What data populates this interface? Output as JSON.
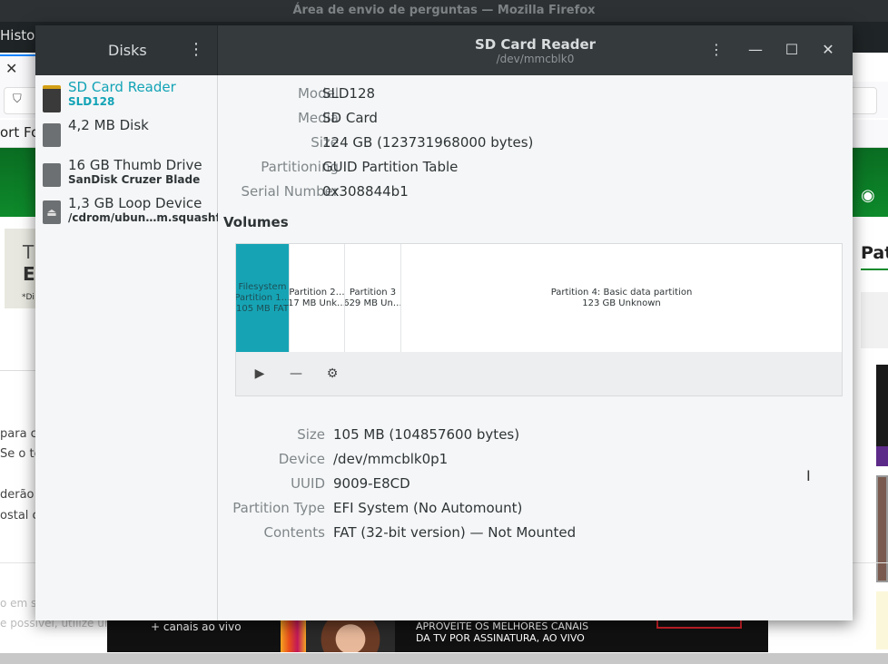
{
  "firefox": {
    "window_title": "Área de envio de perguntas — Mozilla Firefox",
    "history_menu": "Histor",
    "bookmark_text": "ort For",
    "card_text_1": "T",
    "card_text_2": "E",
    "card_text_3": "*Di",
    "side_heading": "Pat",
    "body_lines": [
      "para c",
      "Se o to",
      "derão",
      "ostal co"
    ],
    "footer_lines": [
      "o em s",
      "e possível, utilize un"
    ],
    "banner_left": "+ canais ao vivo",
    "banner_right_1": "APROVEITE OS MELHORES CANAIS",
    "banner_right_2": "DA TV POR ASSINATURA, AO VIVO"
  },
  "disks": {
    "sidebar_title": "Disks",
    "header_title": "SD Card Reader",
    "header_subtitle": "/dev/mmcblk0",
    "drives": [
      {
        "name": "SD Card Reader",
        "sub": "SLD128",
        "icon": "sd-card-icon"
      },
      {
        "name": "4,2 MB Disk",
        "sub": "",
        "icon": "hard-disk-icon"
      },
      {
        "name": "16 GB Thumb Drive",
        "sub": "SanDisk Cruzer Blade",
        "icon": "hard-disk-icon"
      },
      {
        "name": "1,3 GB Loop Device",
        "sub": "/cdrom/ubun…m.squashfs",
        "icon": "optical-disk-icon"
      }
    ],
    "properties": [
      {
        "label": "Model",
        "value": "SLD128"
      },
      {
        "label": "Media",
        "value": "SD Card"
      },
      {
        "label": "Size",
        "value": "124 GB (123731968000 bytes)"
      },
      {
        "label": "Partitioning",
        "value": "GUID Partition Table"
      },
      {
        "label": "Serial Number",
        "value": "0x308844b1"
      }
    ],
    "volumes_title": "Volumes",
    "volumes": [
      {
        "line1": "Filesystem",
        "line2": "Partition 1…",
        "line3": "105 MB FAT"
      },
      {
        "line1": "Partition 2…",
        "line2": "17 MB Unk…",
        "line3": ""
      },
      {
        "line1": "Partition 3",
        "line2": "629 MB Un…",
        "line3": ""
      },
      {
        "line1": "Partition 4: Basic data partition",
        "line2": "123 GB Unknown",
        "line3": ""
      }
    ],
    "volume_properties": [
      {
        "label": "Size",
        "value": "105 MB (104857600 bytes)"
      },
      {
        "label": "Device",
        "value": "/dev/mmcblk0p1"
      },
      {
        "label": "UUID",
        "value": "9009-E8CD"
      },
      {
        "label": "Partition Type",
        "value": "EFI System (No Automount)"
      },
      {
        "label": "Contents",
        "value": "FAT (32-bit version) — Not Mounted"
      }
    ],
    "icons": {
      "menu": "⋮",
      "minimize": "—",
      "maximize": "☐",
      "close": "✕",
      "play": "▶",
      "remove": "—",
      "settings": "⚙"
    },
    "accent_color": "#12a3b6"
  }
}
